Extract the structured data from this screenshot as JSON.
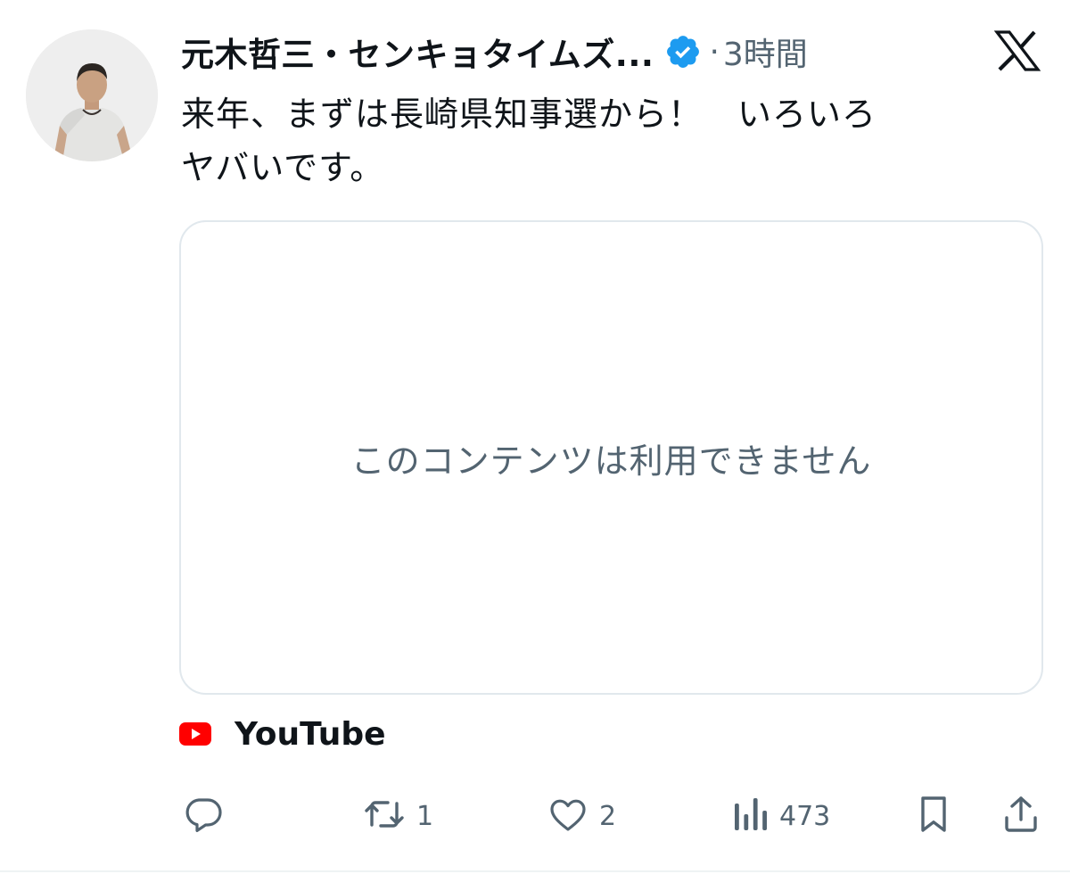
{
  "author": {
    "display_name": "元木哲三・センキョタイムズ...",
    "verified_icon": "verified-badge-icon",
    "separator": "·",
    "timestamp": "3時間",
    "avatar_icon": "profile-photo"
  },
  "platform_icon": "x-logo-icon",
  "tweet": {
    "text_line1": "来年、まずは長崎県知事選から！　いろいろ",
    "text_line2": "ヤバいです。"
  },
  "card": {
    "message": "このコンテンツは利用できません"
  },
  "source": {
    "icon": "youtube-icon",
    "name": "YouTube"
  },
  "actions": {
    "reply_count": "",
    "retweet_count": "1",
    "like_count": "2",
    "views_count": "473"
  },
  "colors": {
    "text": "#0f1419",
    "secondary": "#536471",
    "verified": "#1d9bf0",
    "youtube_red": "#ff0000",
    "border": "#e1e8ed"
  }
}
